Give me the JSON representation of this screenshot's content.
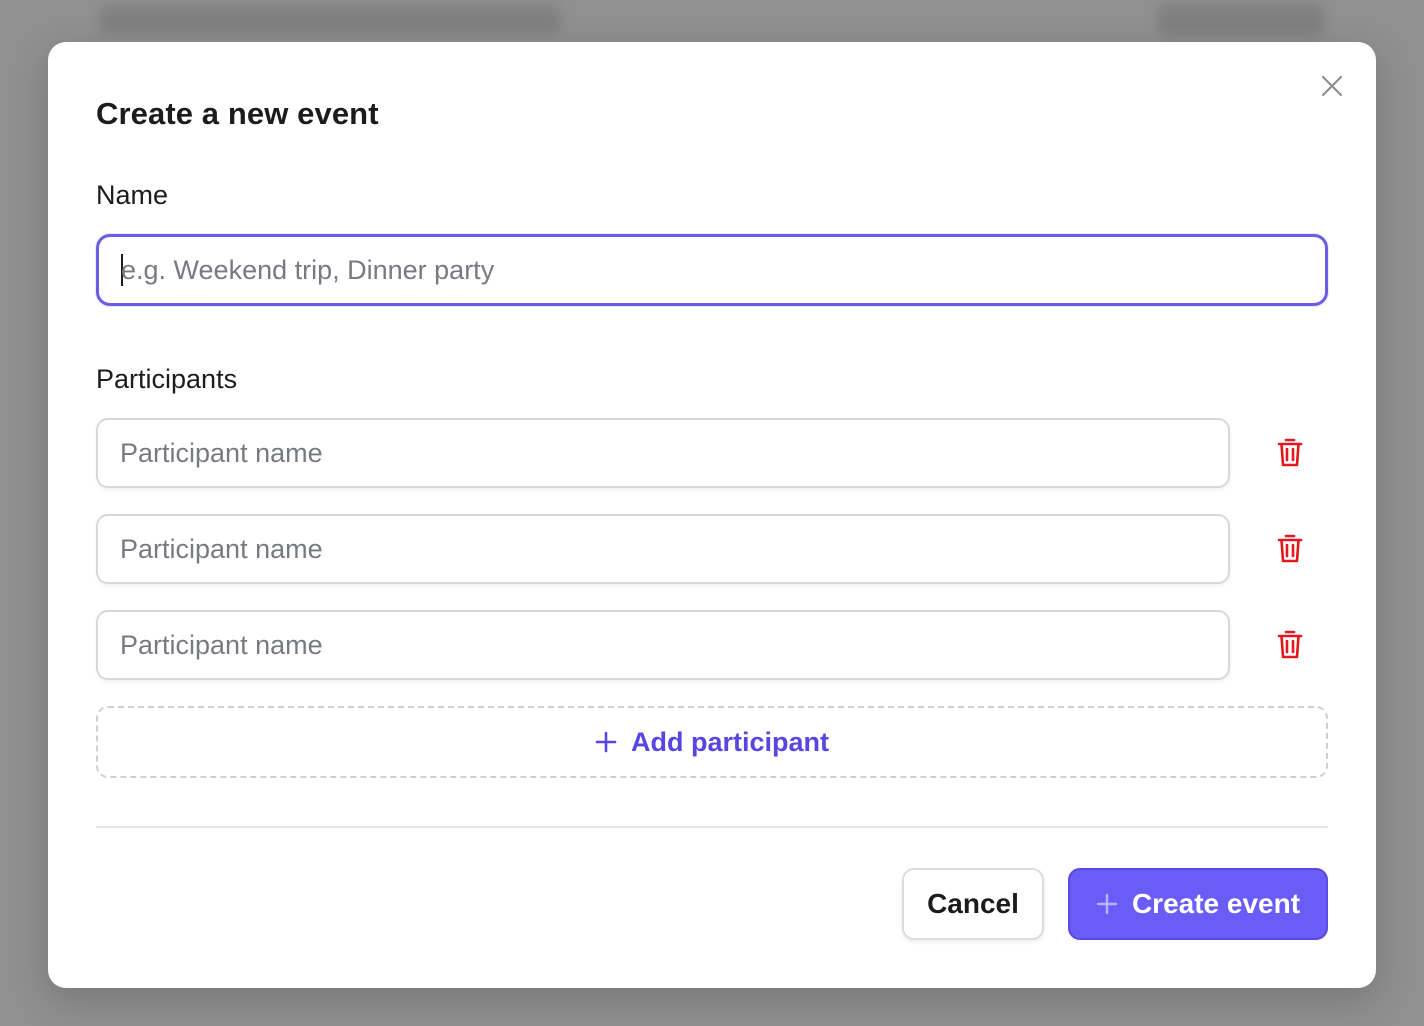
{
  "dialog": {
    "title": "Create a new event",
    "name_label": "Name",
    "name_placeholder": "e.g. Weekend trip, Dinner party",
    "name_value": "",
    "participants_label": "Participants",
    "participants": [
      {
        "placeholder": "Participant name",
        "value": ""
      },
      {
        "placeholder": "Participant name",
        "value": ""
      },
      {
        "placeholder": "Participant name",
        "value": ""
      }
    ],
    "add_participant_label": "Add participant",
    "cancel_label": "Cancel",
    "create_label": "Create event"
  },
  "icons": {
    "close": "close-icon",
    "delete": "trash-icon",
    "add": "plus-icon"
  },
  "colors": {
    "accent": "#6a5cf7",
    "accent_text": "#5746e0",
    "focus_border": "#6b5ce7",
    "danger": "#e0191f"
  }
}
